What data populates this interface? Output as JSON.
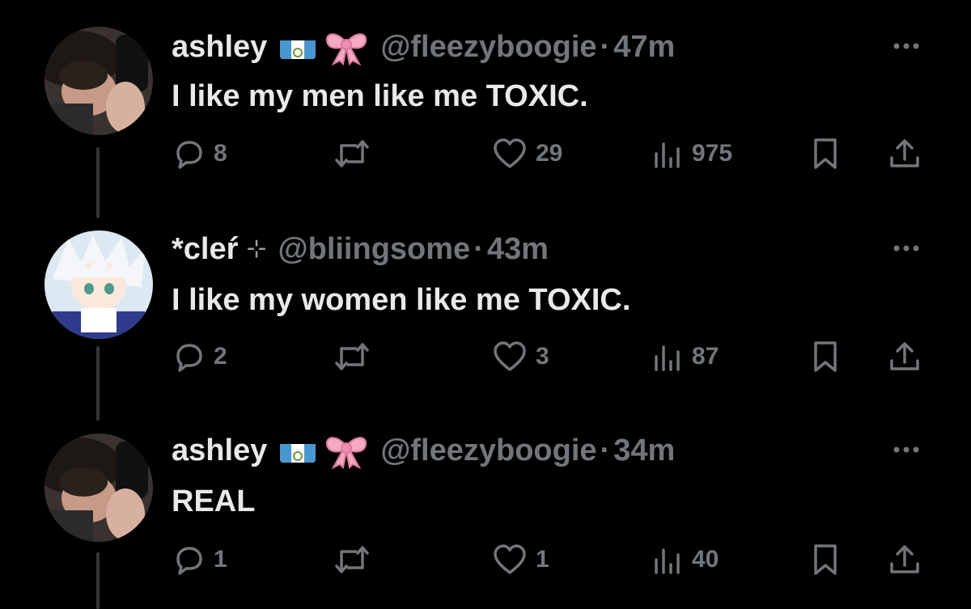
{
  "colors": {
    "background": "#000000",
    "primary_text": "#e7e9ea",
    "secondary_text": "#71767b",
    "thread_line": "#333639"
  },
  "tweets": [
    {
      "name": "ashley",
      "badges": [
        "guatemala-flag-emoji",
        "pink-bow-emoji"
      ],
      "handle": "@fleezyboogie",
      "separator": "·",
      "time": "47m",
      "text": "I like my men like me TOXIC.",
      "replies": "8",
      "retweets": "",
      "likes": "29",
      "views": "975"
    },
    {
      "name": "*cleŕ",
      "badges": [
        "sparkle-symbol"
      ],
      "sparkle": "⊹",
      "handle": "@bliingsome",
      "separator": "·",
      "time": "43m",
      "text": "I like my women like me TOXIC.",
      "replies": "2",
      "retweets": "",
      "likes": "3",
      "views": "87"
    },
    {
      "name": "ashley",
      "badges": [
        "guatemala-flag-emoji",
        "pink-bow-emoji"
      ],
      "handle": "@fleezyboogie",
      "separator": "·",
      "time": "34m",
      "text": "REAL",
      "replies": "1",
      "retweets": "",
      "likes": "1",
      "views": "40"
    }
  ]
}
